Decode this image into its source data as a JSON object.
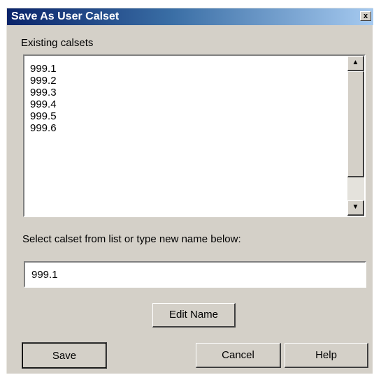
{
  "window": {
    "title": "Save As User Calset",
    "close_label": "x"
  },
  "existing": {
    "label": "Existing calsets",
    "items": [
      "999.1",
      "999.2",
      "999.3",
      "999.4",
      "999.5",
      "999.6"
    ]
  },
  "instruction": "Select calset from list or type new name below:",
  "name_input": {
    "value": "999.1"
  },
  "buttons": {
    "edit_name": "Edit Name",
    "save": "Save",
    "cancel": "Cancel",
    "help": "Help"
  },
  "icons": {
    "scroll_up": "triangle-up-icon",
    "scroll_down": "triangle-down-icon",
    "close": "close-icon"
  }
}
